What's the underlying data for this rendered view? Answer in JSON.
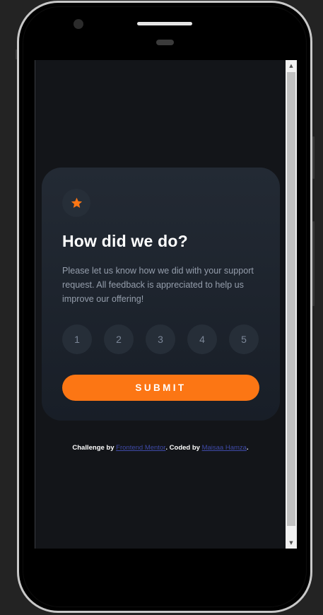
{
  "card": {
    "title": "How did we do?",
    "description": "Please let us know how we did with your support request. All feedback is appreciated to help us improve our offering!",
    "ratings": [
      "1",
      "2",
      "3",
      "4",
      "5"
    ],
    "submit_label": "SUBMIT"
  },
  "attribution": {
    "prefix": "Challenge by ",
    "link1": "Frontend Mentor",
    "middle": ". Coded by ",
    "link2": "Maisaa Hamza",
    "suffix": "."
  },
  "colors": {
    "accent": "#fc7614",
    "card_bg": "#232a34",
    "page_bg": "#131519",
    "link": "#3f4aa8"
  },
  "icons": {
    "badge": "star-icon",
    "scroll_up": "scroll-up-arrow-icon",
    "scroll_down": "scroll-down-arrow-icon"
  }
}
